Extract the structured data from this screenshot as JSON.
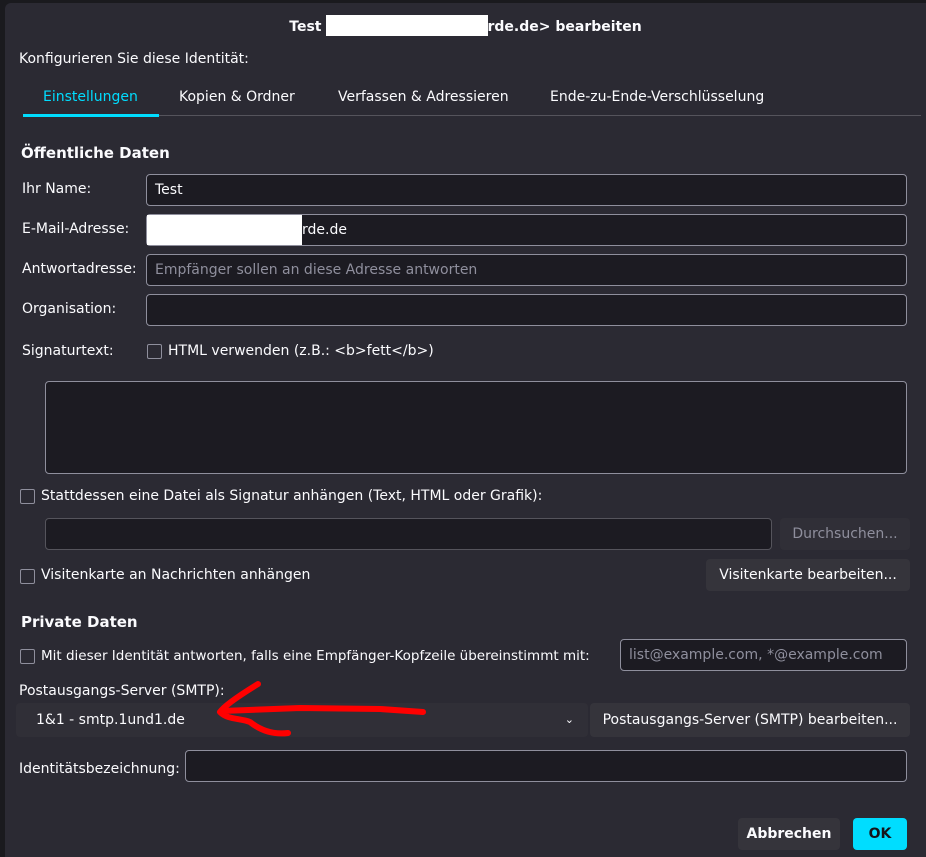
{
  "dialog": {
    "title_prefix": "Test",
    "title_suffix": "rde.de> bearbeiten",
    "subtitle": "Konfigurieren Sie diese Identität:"
  },
  "tabs": [
    {
      "label": "Einstellungen",
      "active": true
    },
    {
      "label": "Kopien & Ordner"
    },
    {
      "label": "Verfassen & Adressieren"
    },
    {
      "label": "Ende-zu-Ende-Verschlüsselung"
    }
  ],
  "public": {
    "heading": "Öffentliche Daten",
    "name_label": "Ihr Name:",
    "name_value": "Test",
    "email_label": "E-Mail-Adresse:",
    "email_value_suffix": "rde.de",
    "reply_label": "Antwortadresse:",
    "reply_placeholder": "Empfänger sollen an diese Adresse antworten",
    "org_label": "Organisation:",
    "sig_label": "Signaturtext:",
    "html_checkbox": "HTML verwenden (z.B.: <b>fett</b>)",
    "file_sig_checkbox": "Stattdessen eine Datei als Signatur anhängen (Text, HTML oder Grafik):",
    "browse_button": "Durchsuchen...",
    "vcard_checkbox": "Visitenkarte an Nachrichten anhängen",
    "vcard_button": "Visitenkarte bearbeiten..."
  },
  "private": {
    "heading": "Private Daten",
    "reply_match_checkbox": "Mit dieser Identität antworten, falls eine Empfänger-Kopfzeile übereinstimmt mit:",
    "reply_match_placeholder": "list@example.com, *@example.com",
    "smtp_label": "Postausgangs-Server (SMTP):",
    "smtp_value": "1&1 - smtp.1und1.de",
    "smtp_edit_button": "Postausgangs-Server (SMTP) bearbeiten...",
    "identity_label": "Identitätsbezeichnung:"
  },
  "footer": {
    "cancel": "Abbrechen",
    "ok": "OK"
  },
  "colors": {
    "accent": "#00ddff",
    "annotation": "#ff0000"
  }
}
